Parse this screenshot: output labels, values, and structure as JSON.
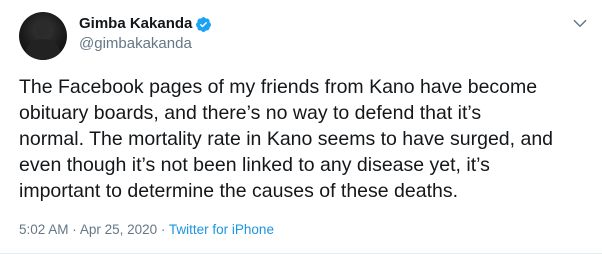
{
  "author": {
    "display_name": "Gimba Kakanda",
    "handle": "@gimbakakanda",
    "verified": true
  },
  "tweet": {
    "lines": [
      "The Facebook pages of my friends from Kano have become",
      "obituary boards, and there’s no way to defend that it’s",
      "normal. The mortality rate in Kano seems to have surged, and",
      "even though it’s not been linked to any disease yet, it’s",
      "important to determine the causes of these deaths."
    ],
    "time": "5:02 AM",
    "separator": "·",
    "date": "Apr 25, 2020",
    "source": "Twitter for iPhone"
  },
  "colors": {
    "text": "#14171a",
    "secondary": "#657786",
    "link": "#1b95e0",
    "verified": "#1da1f2"
  },
  "icons": {
    "verified": "verified-badge-icon",
    "caret": "chevron-down-icon"
  }
}
